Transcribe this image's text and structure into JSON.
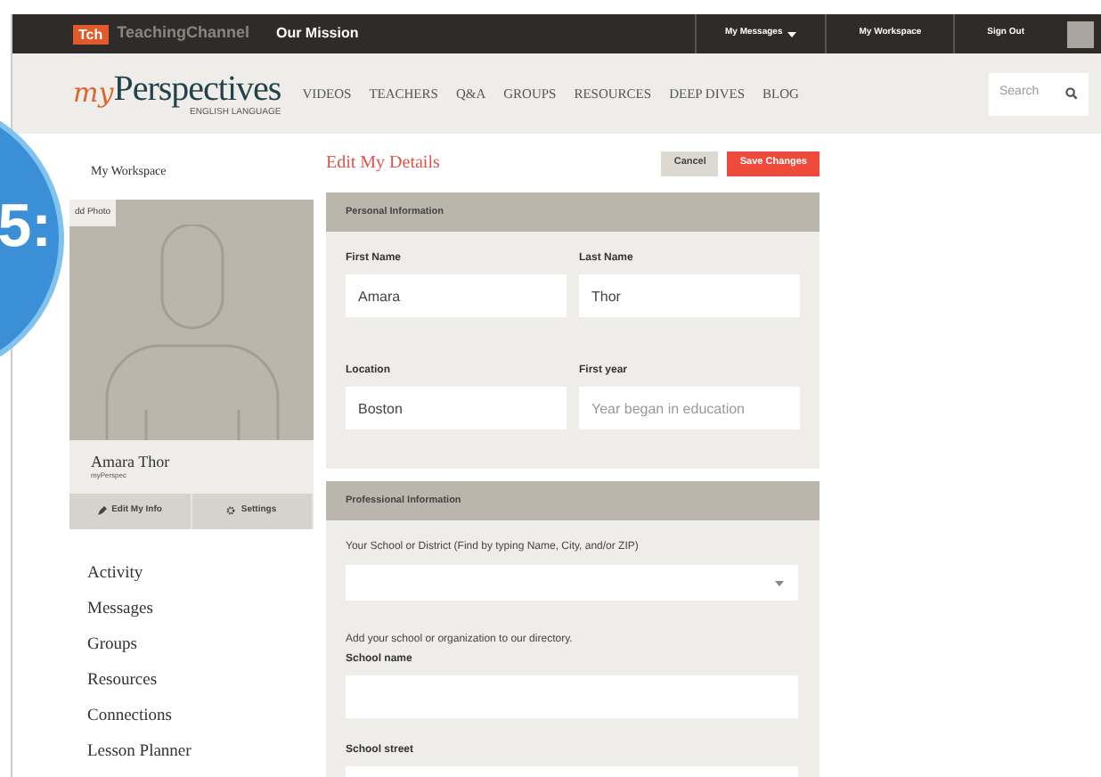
{
  "top_bar": {
    "logo_badge": "Tch",
    "brand": "TeachingChannel",
    "mission": "Our Mission",
    "links": [
      {
        "label": "My Messages",
        "kind": "dropdown"
      },
      {
        "label": "My Workspace",
        "kind": "link"
      },
      {
        "label": "Sign Out",
        "kind": "link"
      }
    ]
  },
  "nav": {
    "logo": {
      "prefix": "my",
      "name": "Perspectives",
      "tagline": "ENGLISH LANGUAGE"
    },
    "items": [
      "VIDEOS",
      "TEACHERS",
      "Q&A",
      "GROUPS",
      "RESOURCES",
      "DEEP DIVES",
      "BLOG"
    ],
    "search": {
      "placeholder": "Search"
    }
  },
  "step_badge": "5:",
  "sidebar": {
    "heading": "My Workspace",
    "photo_label": "dd Photo",
    "name": "Amara Thor",
    "subtitle": "myPerspec",
    "buttons": [
      {
        "label": "Edit My Info",
        "kind": "edit"
      },
      {
        "label": "Settings",
        "kind": "settings"
      }
    ],
    "menu": [
      "Activity",
      "Messages",
      "Groups",
      "Resources",
      "Connections",
      "Lesson Planner"
    ]
  },
  "main": {
    "title": "Edit My Details",
    "cancel": "Cancel",
    "save": "Save Changes",
    "sections": [
      {
        "title": "Personal Information",
        "fields": [
          {
            "kind": "text",
            "label": "First Name",
            "value": "Amara"
          },
          {
            "kind": "text",
            "label": "Last Name",
            "value": "Thor"
          },
          {
            "kind": "text",
            "label": "Location",
            "value": "Boston"
          },
          {
            "kind": "text",
            "label": "First year",
            "placeholder": "Year began in education"
          }
        ]
      },
      {
        "title": "Professional Information",
        "fields": [
          {
            "kind": "select",
            "label": "Your School or District (Find by typing Name, City, and/or ZIP)"
          },
          {
            "kind": "note",
            "label": "Add your school or organization to our directory."
          },
          {
            "kind": "text",
            "label": "School name"
          },
          {
            "kind": "text",
            "label": "School street"
          }
        ]
      }
    ]
  }
}
